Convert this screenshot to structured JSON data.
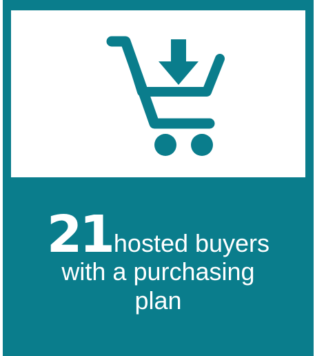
{
  "stat": {
    "number": "21",
    "label_line1": "hosted buyers",
    "label_line2": "with a purchasing",
    "label_line3": "plan"
  },
  "icon": "shopping-cart-download-icon",
  "colors": {
    "teal": "#0a7d8c",
    "white": "#ffffff"
  }
}
